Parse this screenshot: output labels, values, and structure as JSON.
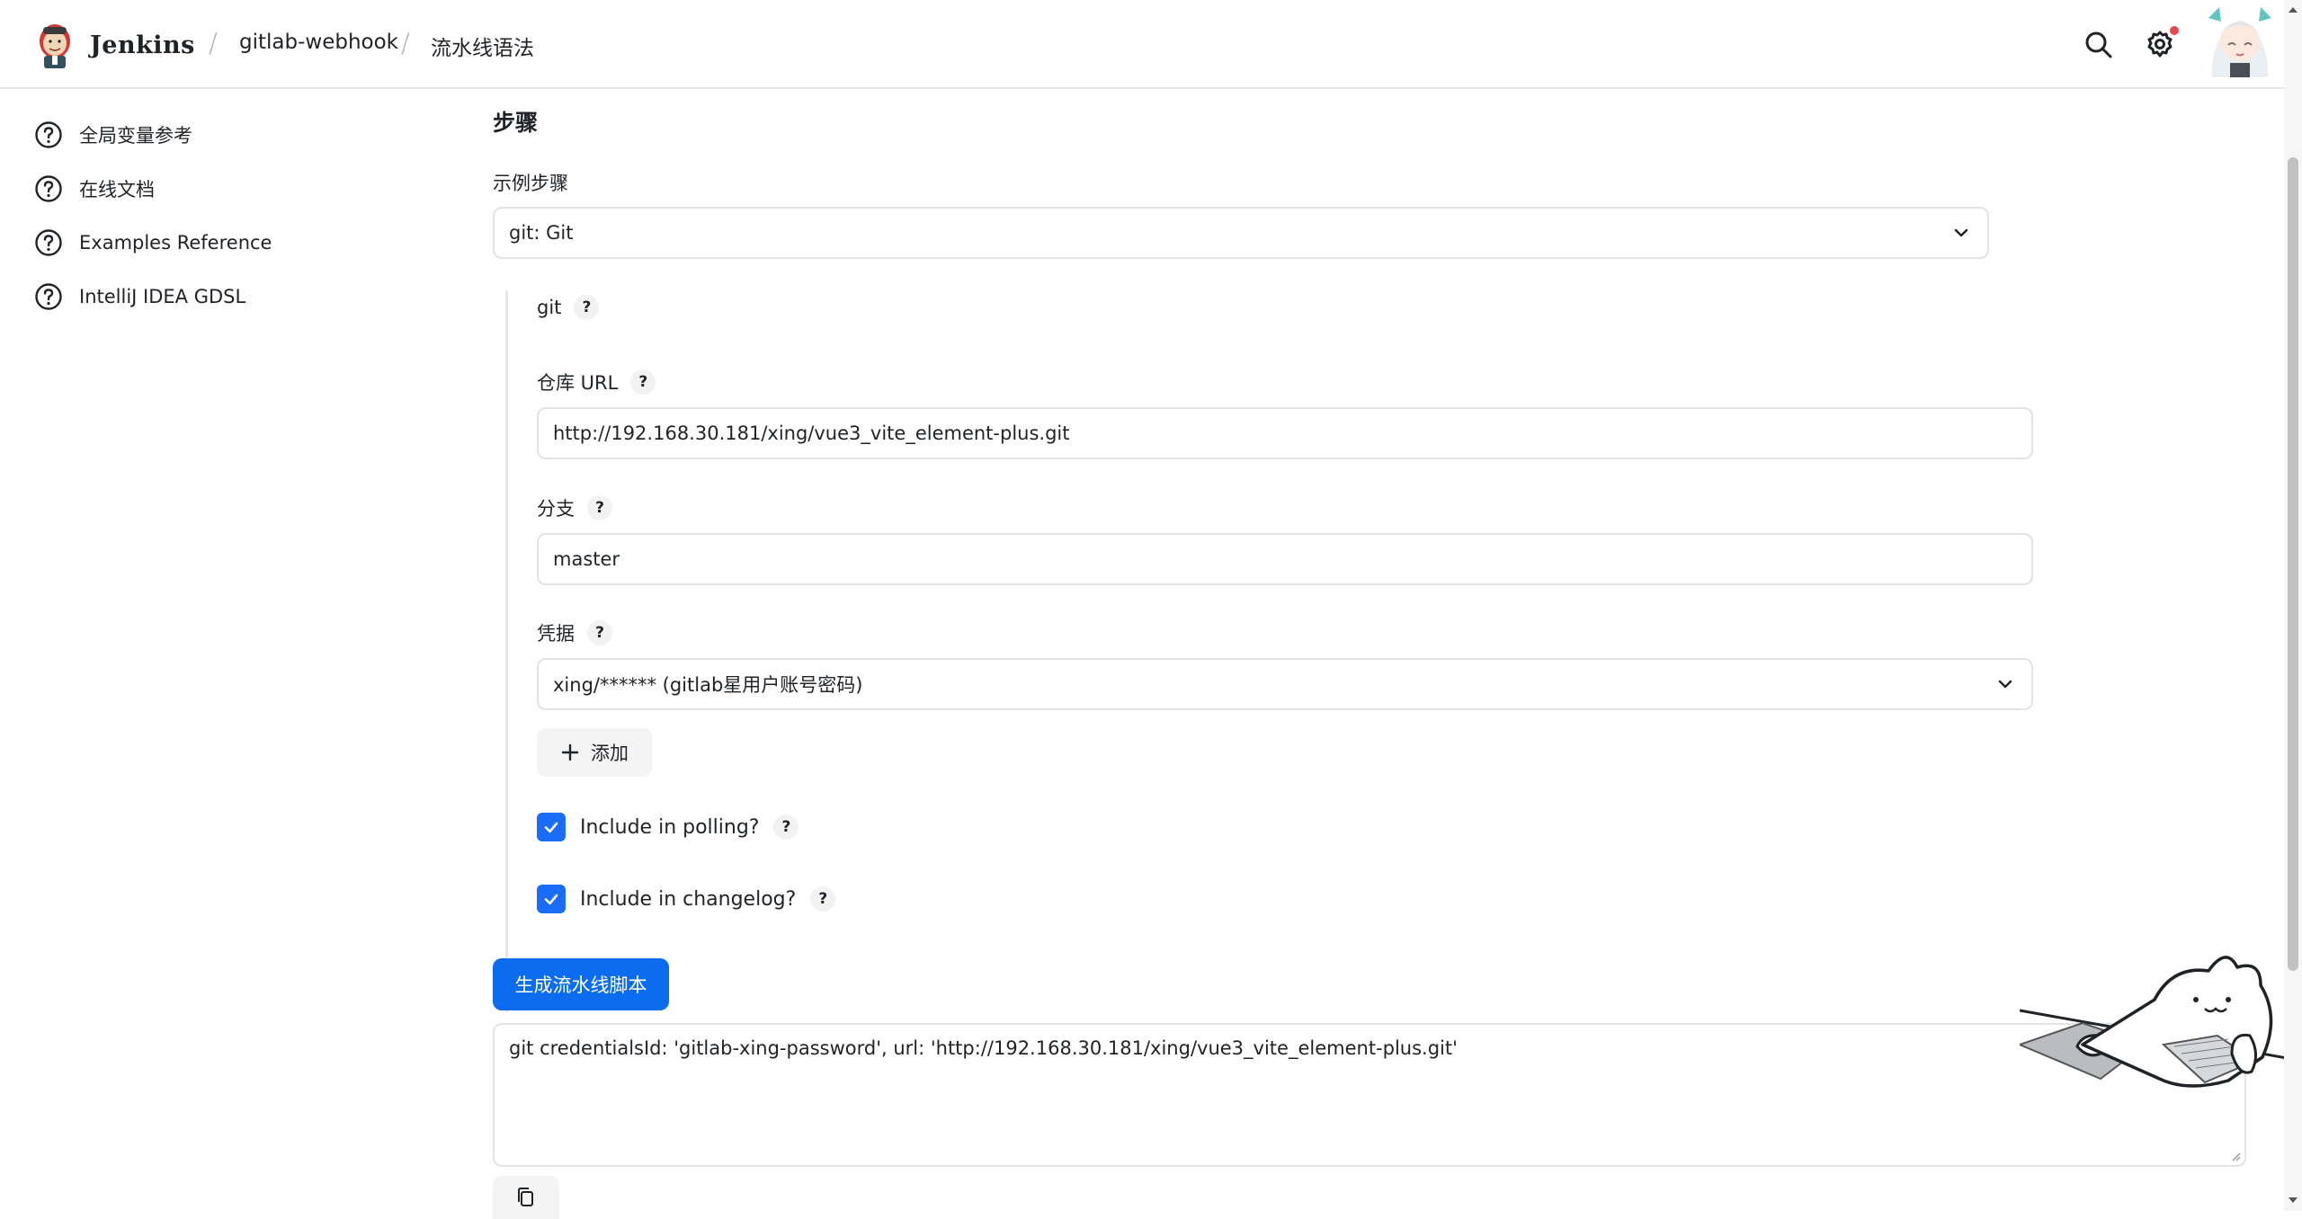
{
  "header": {
    "brand": "Jenkins",
    "breadcrumbs": [
      "gitlab-webhook",
      "流水线语法"
    ],
    "icons": [
      "search-icon",
      "gear-icon"
    ]
  },
  "sidebar": {
    "items": [
      {
        "label": "全局变量参考",
        "icon": "help-circle-icon"
      },
      {
        "label": "在线文档",
        "icon": "help-circle-icon"
      },
      {
        "label": "Examples Reference",
        "icon": "help-circle-icon"
      },
      {
        "label": "IntelliJ IDEA GDSL",
        "icon": "help-circle-icon"
      }
    ]
  },
  "main": {
    "section_title": "步骤",
    "sample_step_label": "示例步骤",
    "sample_step_value": "git: Git",
    "step_name": "git",
    "help_glyph": "?",
    "repo_url_label": "仓库 URL",
    "repo_url_value": "http://192.168.30.181/xing/vue3_vite_element-plus.git",
    "branch_label": "分支",
    "branch_value": "master",
    "credentials_label": "凭据",
    "credentials_value": "xing/****** (gitlab星用户账号密码)",
    "add_button": "添加",
    "include_polling_label": "Include in polling?",
    "include_changelog_label": "Include in changelog?",
    "include_polling_checked": true,
    "include_changelog_checked": true,
    "generate_button": "生成流水线脚本",
    "generated_script": "git credentialsId: 'gitlab-xing-password', url: 'http://192.168.30.181/xing/vue3_vite_element-plus.git'"
  },
  "colors": {
    "primary": "#0b6cf0",
    "checkbox": "#1a6bf5",
    "notification": "#e5484d"
  }
}
